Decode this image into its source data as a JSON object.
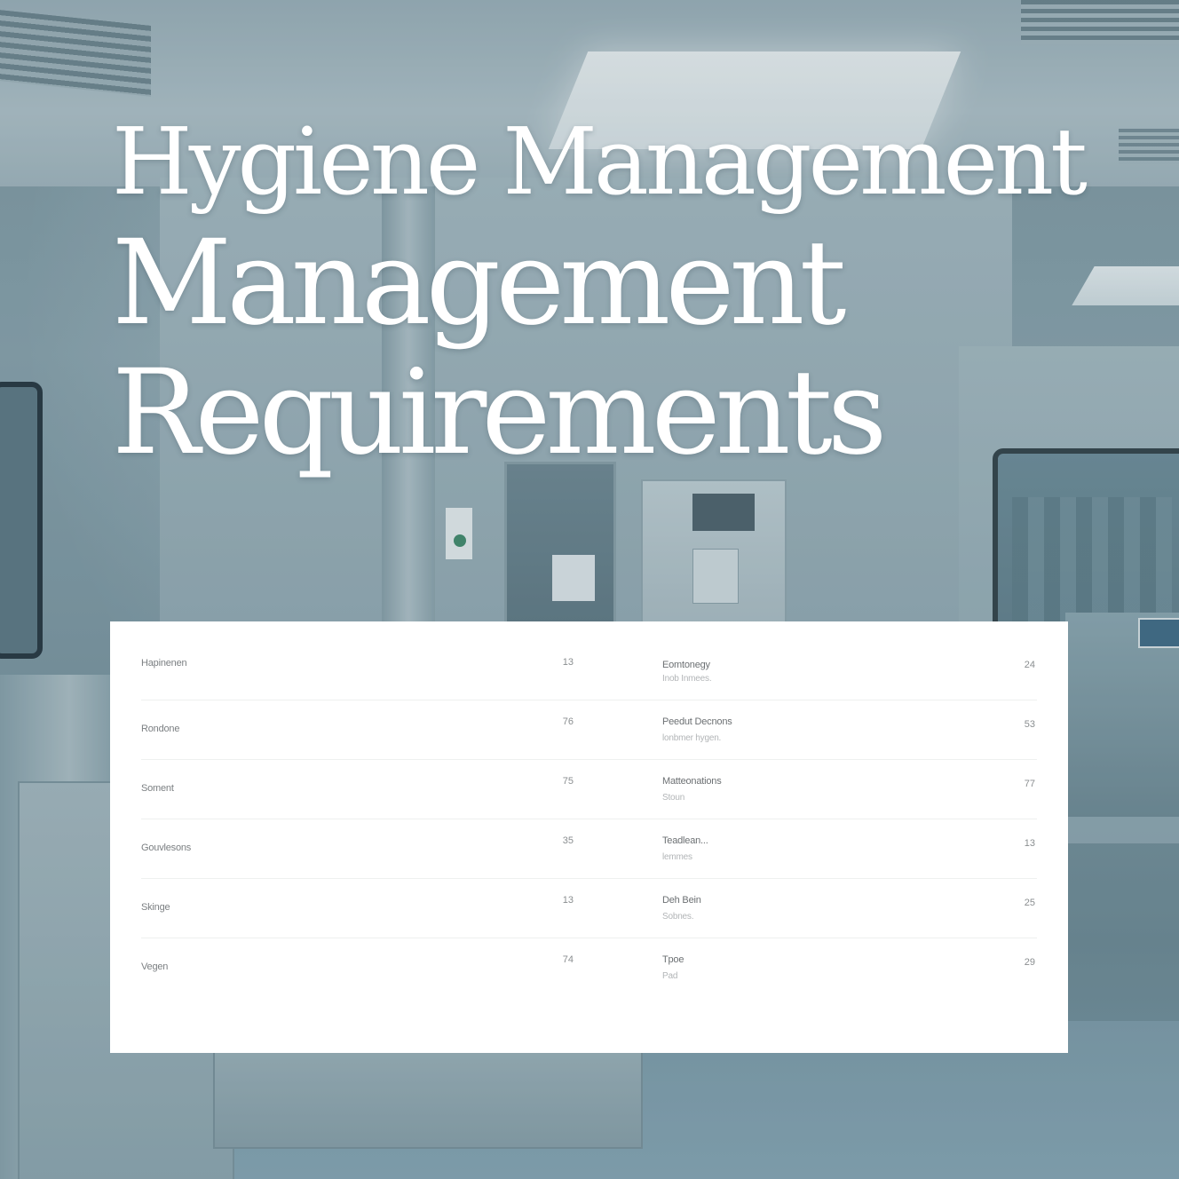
{
  "title": {
    "line1": "Hygiene Management",
    "line2": "Management",
    "line3": "Requirements"
  },
  "table": {
    "left": [
      {
        "label": "Hapinenen",
        "value": "13"
      },
      {
        "label": "Rondone",
        "value": "76"
      },
      {
        "label": "Soment",
        "value": "75"
      },
      {
        "label": "Gouvlesons",
        "value": "35"
      },
      {
        "label": "Skinge",
        "value": "13"
      },
      {
        "label": "Vegen",
        "value": "74"
      }
    ],
    "right": [
      {
        "label": "Eomtonegy",
        "sub": "Inob Inmees.",
        "value": "24"
      },
      {
        "label": "Peedut Decnons",
        "sub": "lonbmer hygen.",
        "value": "53"
      },
      {
        "label": "Matteonations",
        "sub": "Stoun",
        "value": "77"
      },
      {
        "label": "Teadlean...",
        "sub": "lemmes",
        "value": "13"
      },
      {
        "label": "Deh Bein",
        "sub": "Sobnes.",
        "value": "25"
      },
      {
        "label": "Tpoe",
        "sub": "Pad",
        "value": "29"
      }
    ]
  }
}
